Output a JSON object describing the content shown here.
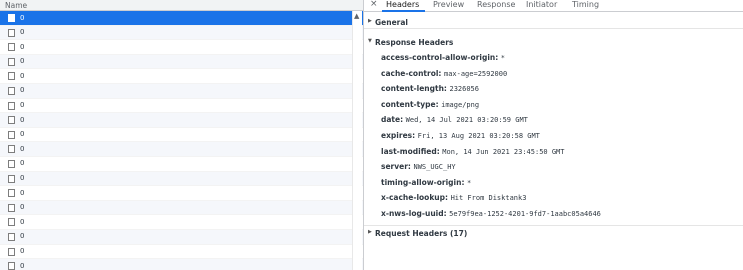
{
  "list": {
    "column_header": "Name",
    "rows": [
      "0",
      "0",
      "0",
      "0",
      "0",
      "0",
      "0",
      "0",
      "0",
      "0",
      "0",
      "0",
      "0",
      "0",
      "0",
      "0",
      "0",
      "0"
    ],
    "selected_index": 0
  },
  "tabs": {
    "close_glyph": "×",
    "items": [
      "Headers",
      "Preview",
      "Response",
      "Initiator",
      "Timing"
    ],
    "active": "Headers"
  },
  "sections": {
    "general": "General",
    "response_headers": "Response Headers",
    "request_headers": "Request Headers (17)"
  },
  "response_headers": [
    {
      "key": "access-control-allow-origin:",
      "value": "*"
    },
    {
      "key": "cache-control:",
      "value": "max-age=2592000"
    },
    {
      "key": "content-length:",
      "value": "2326056"
    },
    {
      "key": "content-type:",
      "value": "image/png"
    },
    {
      "key": "date:",
      "value": "Wed, 14 Jul 2021 03:20:59 GMT"
    },
    {
      "key": "expires:",
      "value": "Fri, 13 Aug 2021 03:20:58 GMT"
    },
    {
      "key": "last-modified:",
      "value": "Mon, 14 Jun 2021 23:45:50 GMT"
    },
    {
      "key": "server:",
      "value": "NWS_UGC_HY"
    },
    {
      "key": "timing-allow-origin:",
      "value": "*"
    },
    {
      "key": "x-cache-lookup:",
      "value": "Hit From Disktank3"
    },
    {
      "key": "x-nws-log-uuid:",
      "value": "5e79f9ea-1252-4201-9fd7-1aabc05a4646"
    }
  ],
  "colors": {
    "selection": "#1a73e8",
    "active_tab_underline": "#1a73e8",
    "header_bg": "#f1f3f4"
  }
}
